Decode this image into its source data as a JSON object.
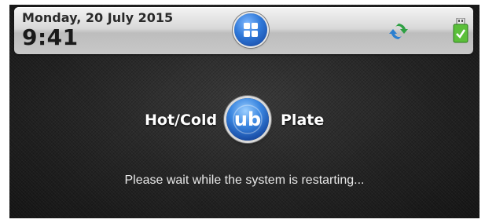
{
  "header": {
    "date": "Monday, 20 July 2015",
    "time": "9:41"
  },
  "icons": {
    "home": "grid-home-icon",
    "sync": "sync-icon",
    "usb": "usb-drive-icon"
  },
  "brand": {
    "left_word": "Hot/Cold",
    "right_word": "Plate",
    "logo_text": "ub"
  },
  "status_message": "Please wait while the system is restarting...",
  "colors": {
    "accent_blue": "#2f78d8",
    "sync_green": "#2ea043",
    "sync_blue": "#2a7fd0",
    "usb_green": "#5bbf3a"
  }
}
